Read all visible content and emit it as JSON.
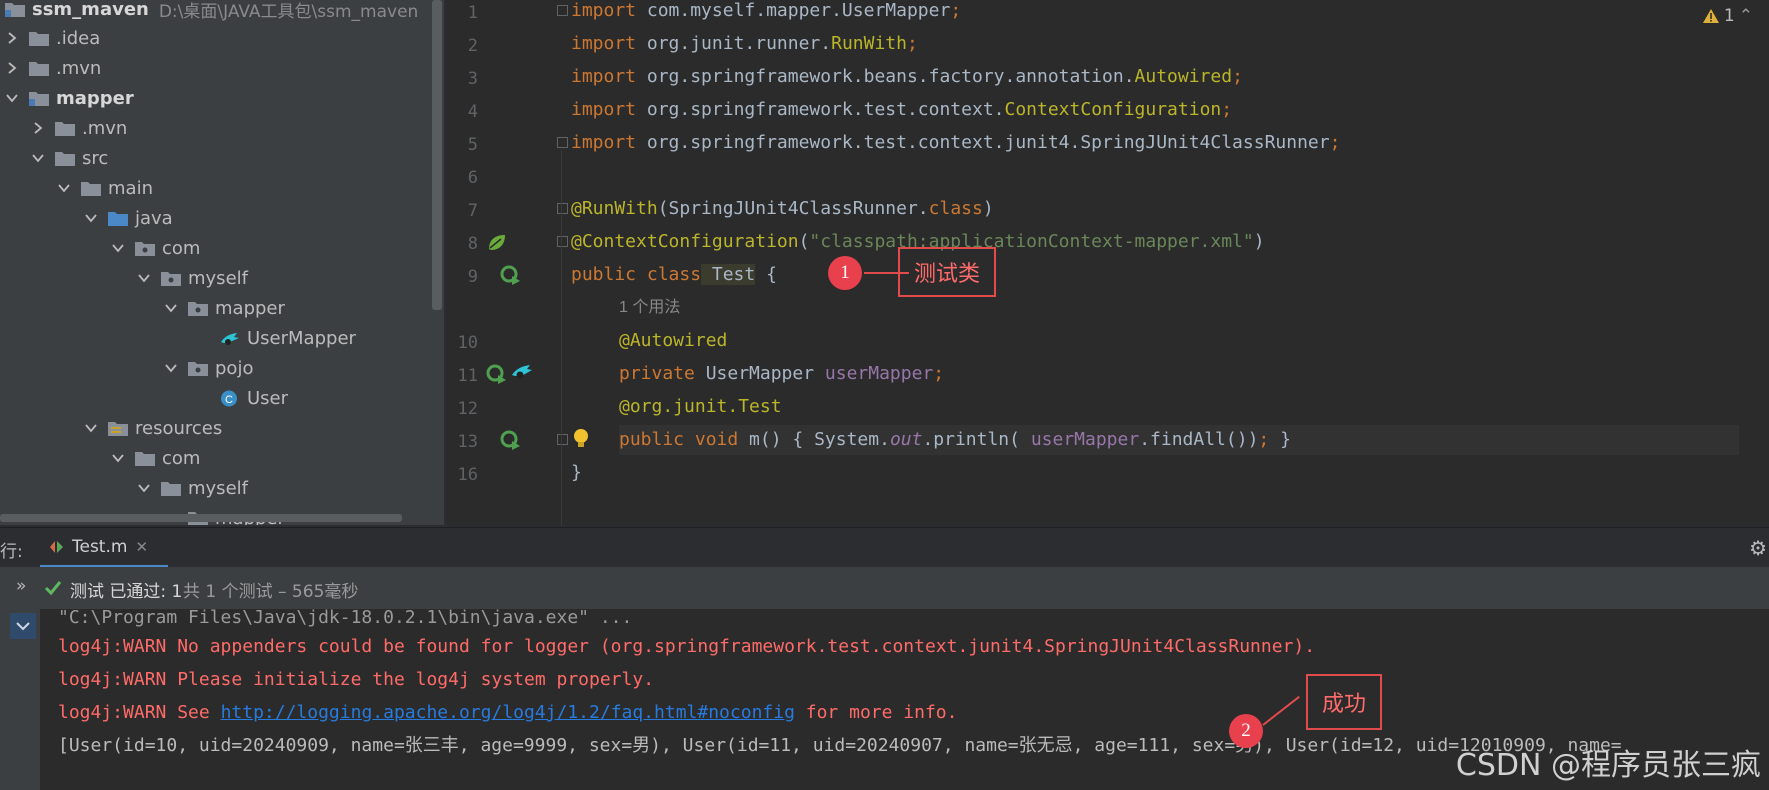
{
  "project": {
    "root_name": "ssm_maven",
    "root_path": "D:\\桌面\\JAVA工具包\\ssm_maven",
    "items": [
      {
        "label": "ssm_maven"
      },
      {
        "label": ".idea"
      },
      {
        "label": ".mvn"
      },
      {
        "label": "mapper"
      },
      {
        "label": ".mvn"
      },
      {
        "label": "src"
      },
      {
        "label": "main"
      },
      {
        "label": "java"
      },
      {
        "label": "com"
      },
      {
        "label": "myself"
      },
      {
        "label": "mapper"
      },
      {
        "label": "UserMapper"
      },
      {
        "label": "pojo"
      },
      {
        "label": "User"
      },
      {
        "label": "resources"
      },
      {
        "label": "com"
      },
      {
        "label": "myself"
      },
      {
        "label": "mapper"
      }
    ]
  },
  "editor": {
    "warning_count": "1",
    "line_numbers": [
      "1",
      "2",
      "3",
      "4",
      "5",
      "6",
      "7",
      "8",
      "9",
      "",
      "10",
      "11",
      "12",
      "13",
      "16"
    ],
    "lines": {
      "l1_kw": "import",
      "l1_pkg": " com.myself.mapper.UserMapper",
      "l1_semi": ";",
      "l2_kw": "import",
      "l2_pkg": " org.junit.runner.",
      "l2_cls": "RunWith",
      "l2_semi": ";",
      "l3_kw": "import",
      "l3_pkg": " org.springframework.beans.factory.annotation.",
      "l3_cls": "Autowired",
      "l3_semi": ";",
      "l4_kw": "import",
      "l4_pkg": " org.springframework.test.context.",
      "l4_cls": "ContextConfiguration",
      "l4_semi": ";",
      "l5_kw": "import",
      "l5_pkg": " org.springframework.test.context.junit4.SpringJUnit4ClassRunner",
      "l5_semi": ";",
      "l7_ann": "@RunWith",
      "l7_rest": "(SpringJUnit4ClassRunner.",
      "l7_kw": "class",
      "l7_end": ")",
      "l8_ann": "@ContextConfiguration",
      "l8_open": "(",
      "l8_str": "\"classpath:applicationContext-mapper.xml\"",
      "l8_end": ")",
      "l9_kw": "public class",
      "l9_name": " Test",
      "l9_end": " {",
      "usage_hint": "1 个用法",
      "l10_ann": "@Autowired",
      "l11_kw": "private",
      "l11_type": " UserMapper ",
      "l11_fld": "userMapper",
      "l11_semi": ";",
      "l12_ann": "@org.junit.Test",
      "l13_kw": "public void",
      "l13_a": " m() { System.",
      "l13_out": "out",
      "l13_b": ".println( ",
      "l13_fld": "userMapper",
      "l13_c": ".findAll())",
      "l13_semi": ";",
      "l13_d": " }",
      "l16": "}"
    }
  },
  "callouts": {
    "one_num": "1",
    "one_text": "测试类",
    "two_num": "2",
    "two_text": "成功"
  },
  "run_panel": {
    "prefix": "行:",
    "tab_label": "Test.m",
    "status_text": "测试 已通过: 1",
    "status_detail": "共 1 个测试 – 565毫秒",
    "console": {
      "cmd": "\"C:\\Program Files\\Java\\jdk-18.0.2.1\\bin\\java.exe\" ...",
      "warn1": "log4j:WARN No appenders could be found for logger (org.springframework.test.context.junit4.SpringJUnit4ClassRunner).",
      "warn2": "log4j:WARN Please initialize the log4j system properly.",
      "warn3_a": "log4j:WARN See ",
      "warn3_link": "http://logging.apache.org/log4j/1.2/faq.html#noconfig",
      "warn3_b": " for more info.",
      "result": "[User(id=10, uid=20240909, name=张三丰, age=9999, sex=男), User(id=11, uid=20240907, name=张无忌, age=111, sex=男), User(id=12, uid=12010909, name="
    }
  },
  "watermark": "CSDN @程序员张三疯",
  "colors": {
    "accent_red": "#e14b4b",
    "keyword": "#cc7832",
    "annotation": "#bbb529",
    "string": "#6a8759",
    "field": "#9876aa"
  }
}
